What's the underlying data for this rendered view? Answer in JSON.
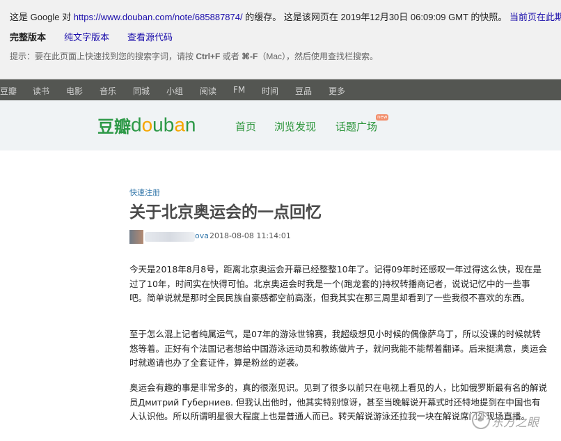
{
  "cache_bar": {
    "prefix": "这是 Google 对 ",
    "url": "https://www.douban.com/note/685887874/",
    "suffix": " 的缓存。 这是该网页在 2019年12月30日 06:09:09 GMT 的快照。 ",
    "current_link": "当前页在此期",
    "views": [
      "完整版本",
      "纯文字版本",
      "查看源代码"
    ],
    "tip_before": "提示：要在此页面上快速找到您的搜索字词，请按 ",
    "tip_key1": "Ctrl+F",
    "tip_mid": " 或者 ",
    "tip_key2": "⌘-F",
    "tip_after": "（Mac），然后使用查找栏搜索。"
  },
  "global_nav": [
    "豆瓣",
    "读书",
    "电影",
    "音乐",
    "同城",
    "小组",
    "阅读",
    "FM",
    "时间",
    "豆品",
    "更多"
  ],
  "header": {
    "logo_cn": "豆瓣",
    "logo_en_1": "d",
    "logo_en_o": "o",
    "logo_en_2": "ub",
    "logo_en_a": "a",
    "logo_en_3": "n",
    "nav": [
      "首页",
      "浏览发现",
      "话题广场"
    ],
    "badge": "new"
  },
  "article": {
    "register": "快速注册",
    "title": "关于北京奥运会的一点回忆",
    "author": "ova",
    "date": "2018-08-08 11:14:01",
    "paragraphs": [
      "今天是2018年8月8号，距离北京奥运会开幕已经整整10年了。记得09年时还感叹一年过得这么快，现在是过了10年，时间实在快得可怕。北京奥运会时我是一个(跑龙套的)持权转播商记者，说说记忆中的一些事吧。简单说就是那时全民民族自豪感都空前高涨，但我其实在那三周里却看到了一些我很不喜欢的东西。",
      "至于怎么混上记者纯属运气，是07年的游泳世锦赛，我超级想见小时候的偶像萨乌丁，所以没课的时候就转悠等着。正好有个法国记者想给中国游泳运动员和教练做片子，就问我能不能帮着翻译。后来挺满意，奥运会时就邀请也办了全套证件，算是粉丝的逆袭。",
      "奥运会有趣的事是非常多的，真的很涨见识。见到了很多以前只在电视上看见的人，比如俄罗斯最有名的解说员Дмитрий Губерниев. 但我认出他时，他其实特别惊讶，甚至当晚解说开幕式时还特地提到在中国也有人认识他。所以所谓明星很大程度上也是普通人而已。转天解说游泳还拉我一块在解说席门外现场直播。"
    ]
  },
  "watermark": "东方之眼"
}
